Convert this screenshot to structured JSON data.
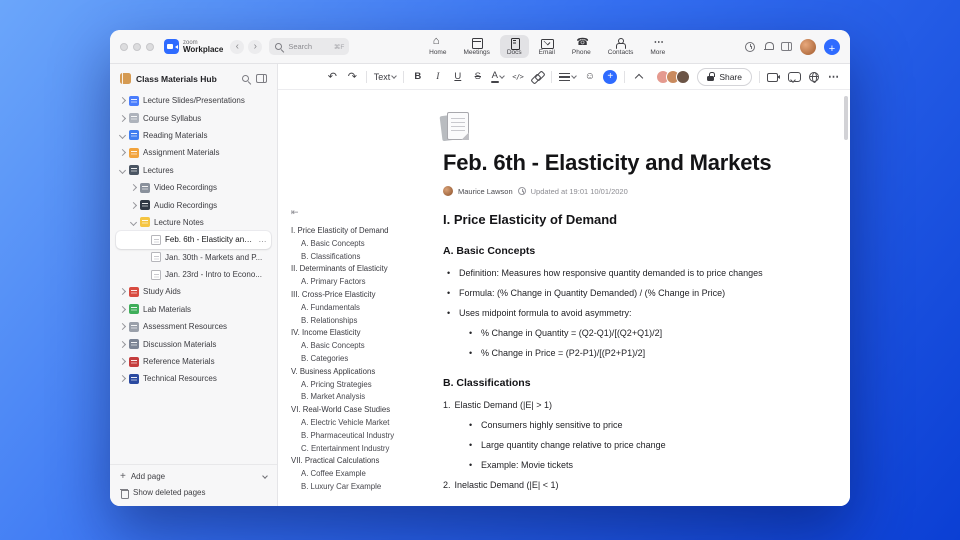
{
  "colors": {
    "accent_blue": "#2f6bff",
    "desktop_top": "#6ba6fa",
    "desktop_mid": "#3570f2",
    "desktop_bottom": "#0b3fd4"
  },
  "titlebar": {
    "logo_top": "zoom",
    "logo_bottom": "Workplace",
    "search_placeholder": "Search",
    "search_shortcut": "⌘F",
    "tabs": [
      {
        "name": "home",
        "label": "Home",
        "active": false
      },
      {
        "name": "meetings",
        "label": "Meetings",
        "active": false
      },
      {
        "name": "docs",
        "label": "Docs",
        "active": true
      },
      {
        "name": "email",
        "label": "Email",
        "active": false
      },
      {
        "name": "phone",
        "label": "Phone",
        "active": false
      },
      {
        "name": "contacts",
        "label": "Contacts",
        "active": false
      },
      {
        "name": "more",
        "label": "More",
        "active": false
      }
    ]
  },
  "sidebar": {
    "title": "Class Materials Hub",
    "tree": [
      {
        "id": "lecture-slides",
        "label": "Lecture Slides/Presentations",
        "icon": "presentation",
        "level": 0,
        "chevron": "right"
      },
      {
        "id": "course-syllabus",
        "label": "Course Syllabus",
        "icon": "syllabus",
        "level": 0,
        "chevron": "right"
      },
      {
        "id": "reading-materials",
        "label": "Reading Materials",
        "icon": "book",
        "level": 0,
        "chevron": "down"
      },
      {
        "id": "assignment-materials",
        "label": "Assignment Materials",
        "icon": "assignment",
        "level": 0,
        "chevron": "right"
      },
      {
        "id": "lectures",
        "label": "Lectures",
        "icon": "lectures",
        "level": 0,
        "chevron": "down"
      },
      {
        "id": "video-recordings",
        "label": "Video Recordings",
        "icon": "video",
        "level": 1,
        "chevron": "right"
      },
      {
        "id": "audio-recordings",
        "label": "Audio Recordings",
        "icon": "audio",
        "level": 1,
        "chevron": "right"
      },
      {
        "id": "lecture-notes",
        "label": "Lecture Notes",
        "icon": "notes",
        "level": 1,
        "chevron": "down"
      },
      {
        "id": "feb-6-elasticity",
        "label": "Feb. 6th - Elasticity and M...",
        "icon": "page",
        "level": 2,
        "selected": true
      },
      {
        "id": "jan-30-markets",
        "label": "Jan. 30th - Markets and P...",
        "icon": "page",
        "level": 2
      },
      {
        "id": "jan-23-intro",
        "label": "Jan. 23rd - Intro to Econo...",
        "icon": "page",
        "level": 2
      },
      {
        "id": "study-aids",
        "label": "Study Aids",
        "icon": "study",
        "level": 0,
        "chevron": "right"
      },
      {
        "id": "lab-materials",
        "label": "Lab Materials",
        "icon": "lab",
        "level": 0,
        "chevron": "right"
      },
      {
        "id": "assessment-resources",
        "label": "Assessment Resources",
        "icon": "clipboard",
        "level": 0,
        "chevron": "right"
      },
      {
        "id": "discussion-materials",
        "label": "Discussion Materials",
        "icon": "discussion",
        "level": 0,
        "chevron": "right"
      },
      {
        "id": "reference-materials",
        "label": "Reference Materials",
        "icon": "reference",
        "level": 0,
        "chevron": "right"
      },
      {
        "id": "technical-resources",
        "label": "Technical Resources",
        "icon": "technical",
        "level": 0,
        "chevron": "right"
      }
    ],
    "footer": {
      "add_page": "Add page",
      "show_deleted": "Show deleted pages"
    }
  },
  "toolbar": {
    "left": [
      {
        "name": "undo",
        "glyph": "↶"
      },
      {
        "name": "redo",
        "glyph": "↷"
      },
      {
        "name": "divider"
      },
      {
        "name": "text-style",
        "label": "Text",
        "chev": true
      },
      {
        "name": "divider"
      },
      {
        "name": "bold",
        "glyph": "B"
      },
      {
        "name": "italic",
        "glyph": "I"
      },
      {
        "name": "underline",
        "glyph": "U"
      },
      {
        "name": "strikethrough",
        "glyph": "S"
      },
      {
        "name": "text-color",
        "glyph": "A",
        "chev": true
      },
      {
        "name": "code",
        "glyph": "</>"
      },
      {
        "name": "link"
      },
      {
        "name": "divider"
      },
      {
        "name": "list",
        "chev": true
      },
      {
        "name": "emoji",
        "glyph": "☺"
      },
      {
        "name": "insert"
      },
      {
        "name": "divider"
      },
      {
        "name": "collapse"
      }
    ],
    "right": [
      {
        "name": "camera"
      },
      {
        "name": "chat"
      },
      {
        "name": "globe"
      },
      {
        "name": "more",
        "glyph": "⋯"
      }
    ],
    "collaborators": [
      {
        "color": "#e59a8f"
      },
      {
        "color": "#c98a5e"
      },
      {
        "color": "#6b5446"
      }
    ],
    "share_label": "Share"
  },
  "outline": [
    {
      "text": "I. Price Elasticity of Demand",
      "level": 0
    },
    {
      "text": "A. Basic Concepts",
      "level": 1
    },
    {
      "text": "B. Classifications",
      "level": 1
    },
    {
      "text": "II. Determinants of Elasticity",
      "level": 0
    },
    {
      "text": "A. Primary Factors",
      "level": 1
    },
    {
      "text": "III. Cross-Price Elasticity",
      "level": 0
    },
    {
      "text": "A. Fundamentals",
      "level": 1
    },
    {
      "text": "B. Relationships",
      "level": 1
    },
    {
      "text": "IV. Income Elasticity",
      "level": 0
    },
    {
      "text": "A. Basic Concepts",
      "level": 1
    },
    {
      "text": "B. Categories",
      "level": 1
    },
    {
      "text": "V. Business Applications",
      "level": 0
    },
    {
      "text": "A. Pricing Strategies",
      "level": 1
    },
    {
      "text": "B. Market Analysis",
      "level": 1
    },
    {
      "text": "VI. Real-World Case Studies",
      "level": 0
    },
    {
      "text": "A. Electric Vehicle Market",
      "level": 1
    },
    {
      "text": "B. Pharmaceutical Industry",
      "level": 1
    },
    {
      "text": "C. Entertainment Industry",
      "level": 1
    },
    {
      "text": "VII. Practical Calculations",
      "level": 0
    },
    {
      "text": "A. Coffee Example",
      "level": 1
    },
    {
      "text": "B. Luxury Car Example",
      "level": 1
    }
  ],
  "doc": {
    "title": "Feb. 6th - Elasticity and Markets",
    "author": "Maurice Lawson",
    "updated": "Updated at 19:01 10/01/2020",
    "blocks": [
      {
        "type": "h1",
        "text": "I. Price Elasticity of Demand"
      },
      {
        "type": "h2",
        "text": "A. Basic Concepts"
      },
      {
        "type": "bullet",
        "level": 0,
        "text": "Definition: Measures how responsive quantity demanded is to price changes"
      },
      {
        "type": "bullet",
        "level": 0,
        "text": "Formula: (% Change in Quantity Demanded) / (% Change in Price)"
      },
      {
        "type": "bullet",
        "level": 0,
        "text": "Uses midpoint formula to avoid asymmetry:"
      },
      {
        "type": "bullet",
        "level": 1,
        "text": "% Change in Quantity = (Q2-Q1)/[(Q2+Q1)/2]"
      },
      {
        "type": "bullet",
        "level": 1,
        "text": "% Change in Price = (P2-P1)/[(P2+P1)/2]"
      },
      {
        "type": "h2",
        "text": "B. Classifications"
      },
      {
        "type": "number",
        "marker": "1.",
        "text": "Elastic Demand (|E| > 1)"
      },
      {
        "type": "bullet",
        "level": 1,
        "text": "Consumers highly sensitive to price"
      },
      {
        "type": "bullet",
        "level": 1,
        "text": "Large quantity change relative to price change"
      },
      {
        "type": "bullet",
        "level": 1,
        "text": "Example: Movie tickets"
      },
      {
        "type": "number",
        "marker": "2.",
        "text": "Inelastic Demand (|E| < 1)"
      }
    ]
  }
}
